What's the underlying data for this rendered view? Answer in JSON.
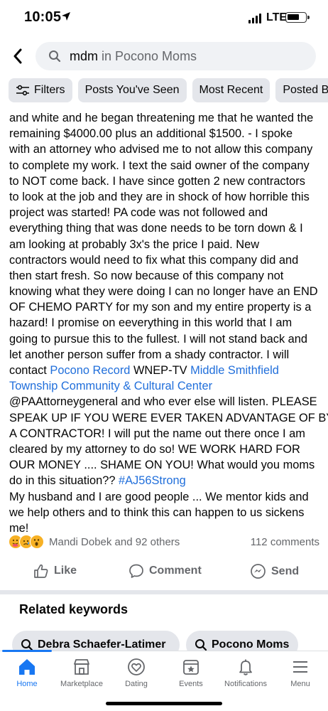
{
  "status_bar": {
    "time": "10:05",
    "network": "LTE"
  },
  "search": {
    "term": "mdm",
    "context": " in Pocono Moms"
  },
  "filters": [
    {
      "label": "Filters"
    },
    {
      "label": "Posts You've Seen"
    },
    {
      "label": "Most Recent"
    },
    {
      "label": "Posted By"
    }
  ],
  "post": {
    "lines": [
      "and white and he began threatening me that he wanted the",
      "remaining $4000.00 plus an additional $1500.  - I spoke",
      "with an attorney who advised me to not allow this company",
      "to complete my work. I text the said owner of the company",
      "to NOT come back. I have since gotten 2 new contractors",
      "to look at the job and they are in shock of how horrible this",
      "project was started! PA code was not followed and",
      "everything thing that was done needs to be torn down & I",
      "am looking at probably 3x's the price I paid. New",
      "contractors would need to fix what this company did and",
      "then start fresh. So now because of this company not",
      "knowing what they were doing I can no longer have an END",
      "OF CHEMO PARTY for my son and my entire property is a",
      "hazard! I promise on eeverything in this world that I am",
      "going to pursue this to the fullest. I will not stand back and",
      "let another person suffer from a shady contractor. I will"
    ],
    "contact_prefix": "contact ",
    "link_pocono_record": "Pocono Record",
    "wnep": " WNEP-TV ",
    "link_middle_1": "Middle Smithfield",
    "link_middle_2": "Township Community & Cultural Center",
    "lines_after_links": [
      "@PAAttorneygeneral and who ever else will listen. PLEASE",
      "SPEAK UP IF YOU WERE EVER TAKEN ADVANTAGE OF BY A",
      "A CONTRACTOR! I will put the name out there once I am",
      "cleared by my attorney to do so! WE WORK HARD FOR",
      "OUR MONEY .... SHAME ON YOU! What would you moms"
    ],
    "hashtag_prefix": "do in this situation?? ",
    "hashtag": "#AJ56Strong",
    "closing_lines": [
      "My husband and I are good people ... We mentor kids and",
      "we help others and to think this can happen to us sickens",
      "me!"
    ]
  },
  "reactions": {
    "names": "Mandi Dobek and 92 others",
    "comments": "112 comments",
    "icons": [
      "care-emoji",
      "sad-emoji",
      "wow-emoji"
    ]
  },
  "actions": {
    "like": "Like",
    "comment": "Comment",
    "send": "Send"
  },
  "related": {
    "title": "Related keywords",
    "keywords": [
      "Debra Schaefer-Latimer",
      "Pocono Moms"
    ]
  },
  "tabs": [
    {
      "label": "Home",
      "icon": "home-icon"
    },
    {
      "label": "Marketplace",
      "icon": "marketplace-icon"
    },
    {
      "label": "Dating",
      "icon": "dating-icon"
    },
    {
      "label": "Events",
      "icon": "events-icon"
    },
    {
      "label": "Notifications",
      "icon": "notifications-icon"
    },
    {
      "label": "Menu",
      "icon": "menu-icon"
    }
  ],
  "colors": {
    "accent": "#1877f2",
    "link": "#216fdb",
    "muted": "#65676b"
  }
}
